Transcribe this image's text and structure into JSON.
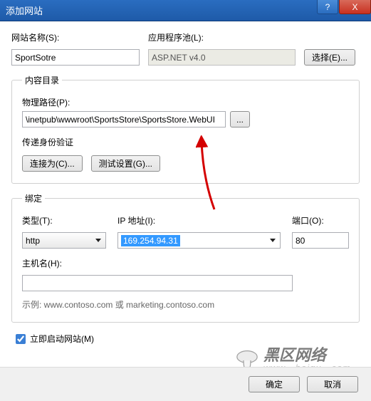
{
  "window": {
    "title": "添加网站",
    "help": "?",
    "close": "X"
  },
  "labels": {
    "siteName": "网站名称(S):",
    "appPool": "应用程序池(L):",
    "select": "选择(E)...",
    "contentGroup": "内容目录",
    "physicalPath": "物理路径(P):",
    "browse": "...",
    "passthrough": "传递身份验证",
    "connectAs": "连接为(C)...",
    "testSettings": "测试设置(G)...",
    "bindingGroup": "绑定",
    "type": "类型(T):",
    "ip": "IP 地址(I):",
    "port": "端口(O):",
    "hostName": "主机名(H):",
    "example": "示例: www.contoso.com 或 marketing.contoso.com",
    "startNow": "立即启动网站(M)",
    "ok": "确定",
    "cancel": "取消"
  },
  "values": {
    "siteName": "SportSotre",
    "appPool": "ASP.NET v4.0",
    "physicalPath": "\\inetpub\\wwwroot\\SportsStore\\SportsStore.WebUI",
    "type": "http",
    "ip": "169.254.94.31",
    "port": "80",
    "hostName": "",
    "startNowChecked": true
  },
  "watermark": {
    "text": "黑区网络",
    "url": "www . heiqu . com"
  }
}
